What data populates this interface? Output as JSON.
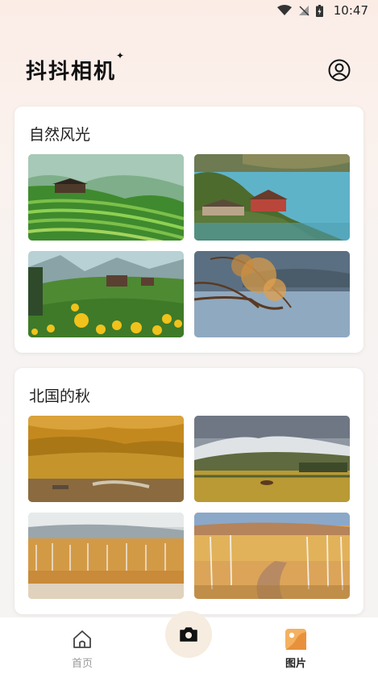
{
  "status_bar": {
    "time": "10:47"
  },
  "header": {
    "title": "抖抖相机",
    "sparkle": "✦"
  },
  "sections": [
    {
      "title": "自然风光",
      "images": [
        "terraced-fields-village",
        "lakeside-village",
        "meadow-yellow-flowers",
        "tree-in-lake"
      ]
    },
    {
      "title": "北国的秋",
      "images": [
        "autumn-forest-field",
        "autumn-mountain-grassland",
        "autumn-birch-lake",
        "autumn-birch-road"
      ]
    }
  ],
  "bottom_nav": {
    "home_label": "首页",
    "pictures_label": "图片"
  },
  "colors": {
    "accent": "#f4b160",
    "camera_bg": "#f6ecdf"
  }
}
